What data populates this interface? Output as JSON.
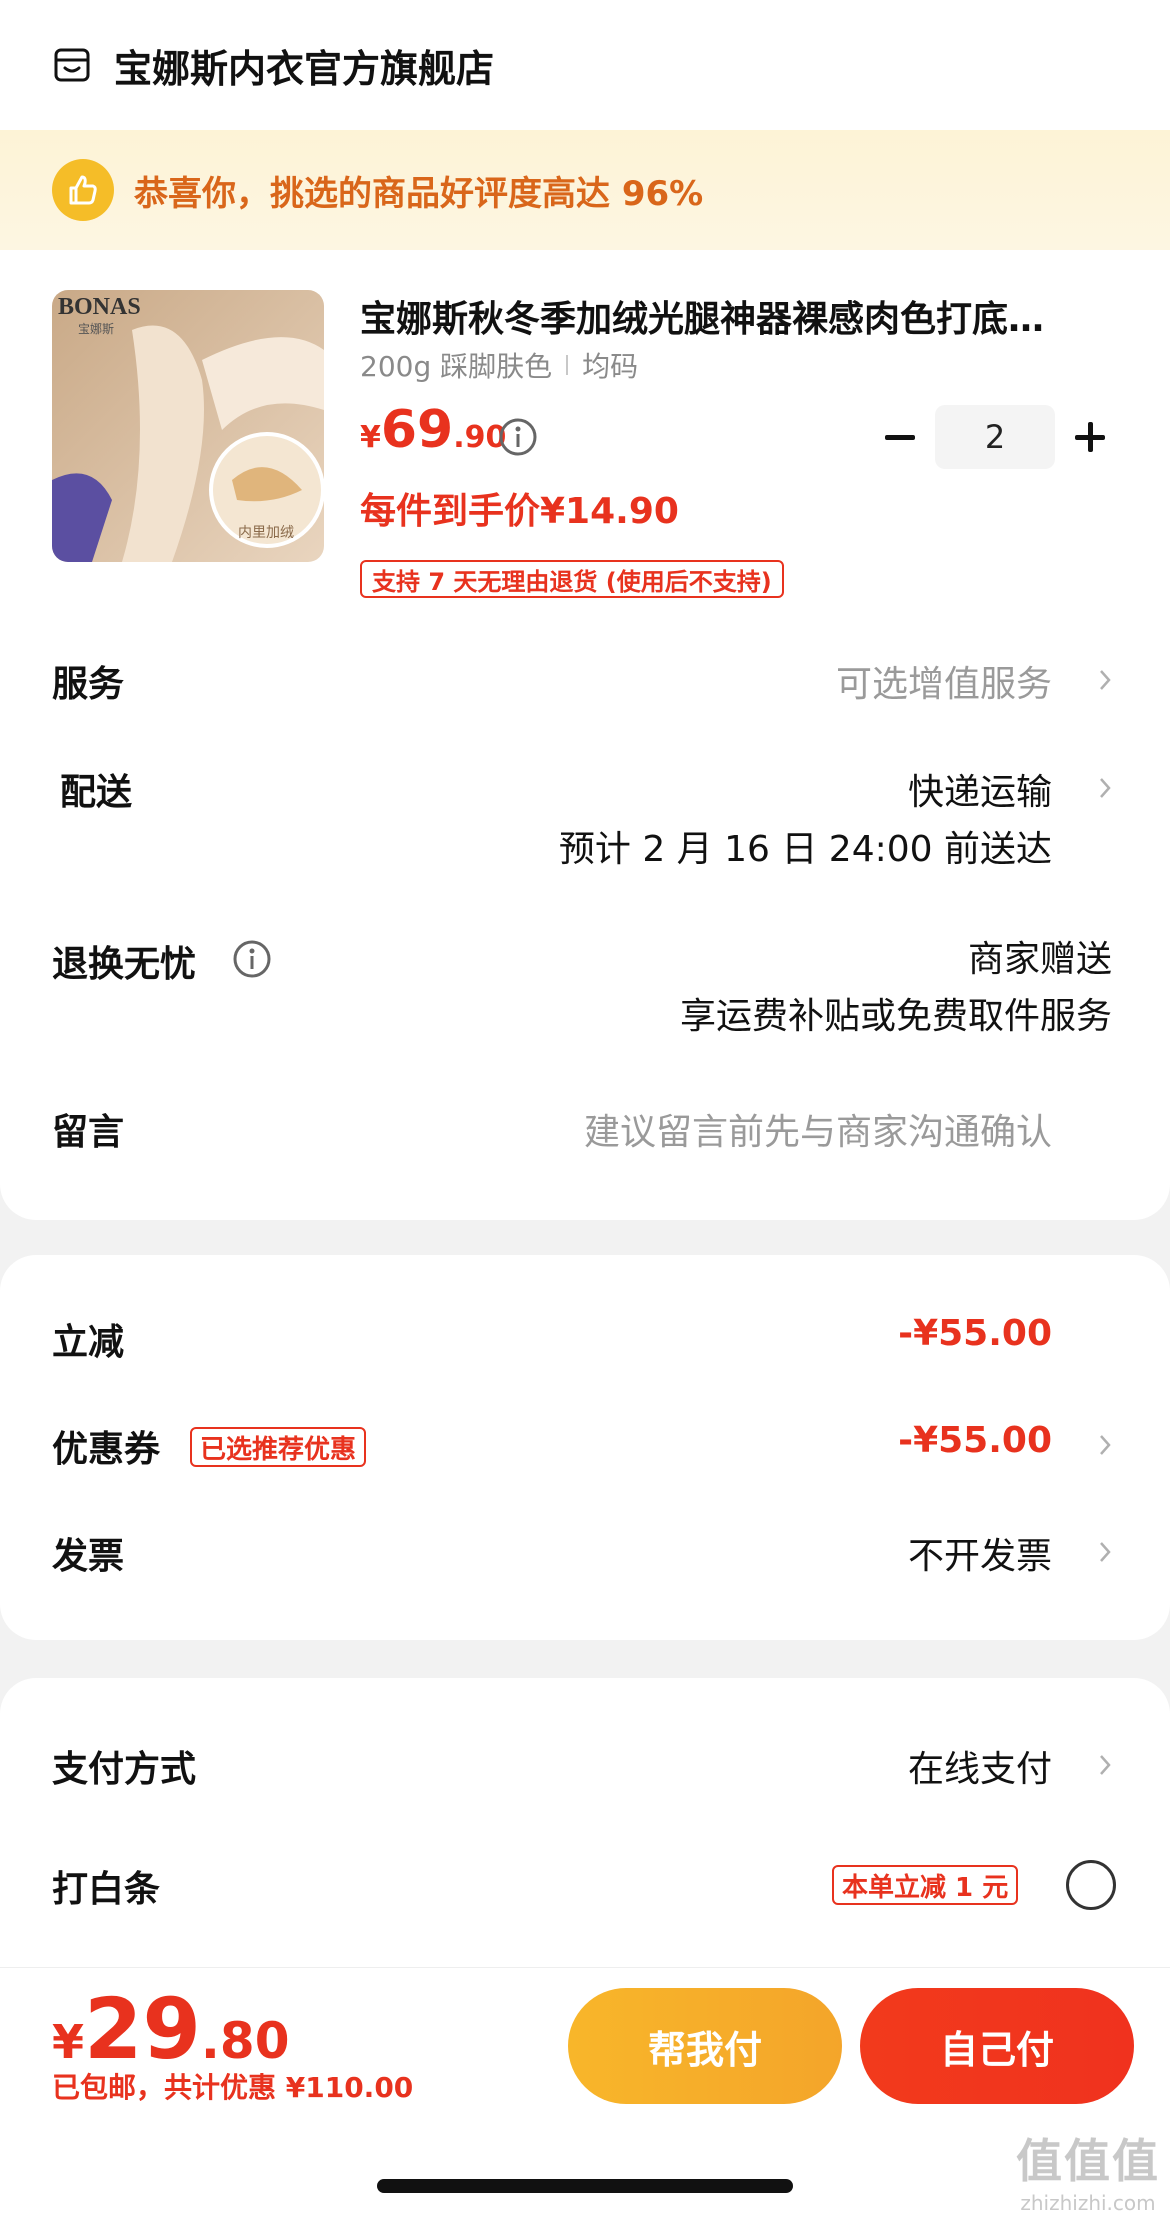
{
  "shop": {
    "name": "宝娜斯内衣官方旗舰店"
  },
  "praise": {
    "text": "恭喜你，挑选的商品好评度高达 96%"
  },
  "product": {
    "image_brand": "BONAS",
    "image_brand_sub": "宝娜斯",
    "image_badge": "内里加绒",
    "title": "宝娜斯秋冬季加绒光腿神器裸感肉色打底…",
    "sku_spec": "200g 踩脚肤色",
    "sku_size": "均码",
    "price_symbol": "¥",
    "price_int": "69",
    "price_dec": ".90",
    "quantity": "2",
    "unit_price": "每件到手价¥14.90",
    "return_tag": "支持 7 天无理由退货 (使用后不支持)"
  },
  "rows": {
    "service_label": "服务",
    "service_value": "可选增值服务",
    "delivery_label": "配送",
    "delivery_method": "快递运输",
    "delivery_eta": "预计 2 月 16 日 24:00 前送达",
    "return_label": "退换无忧",
    "return_value1": "商家赠送",
    "return_value2": "享运费补贴或免费取件服务",
    "message_label": "留言",
    "message_placeholder": "建议留言前先与商家沟通确认"
  },
  "discounts": {
    "instant_label": "立减",
    "instant_value": "-¥55.00",
    "coupon_label": "优惠券",
    "coupon_tag": "已选推荐优惠",
    "coupon_value": "-¥55.00",
    "invoice_label": "发票",
    "invoice_value": "不开发票"
  },
  "payment": {
    "method_label": "支付方式",
    "method_value": "在线支付",
    "credit_label": "打白条",
    "credit_promo": "本单立减 1 元"
  },
  "footer": {
    "total_symbol": "¥",
    "total_int": "29",
    "total_dec": ".80",
    "total_sub": "已包邮，共计优惠 ¥110.00",
    "help_pay": "帮我付",
    "self_pay": "自己付"
  },
  "watermark": {
    "big": "值值值",
    "small": "zhizhizhi.com"
  },
  "colors": {
    "accent": "#e8321e",
    "gold": "#f4a52a",
    "banner_text": "#d9661a"
  }
}
